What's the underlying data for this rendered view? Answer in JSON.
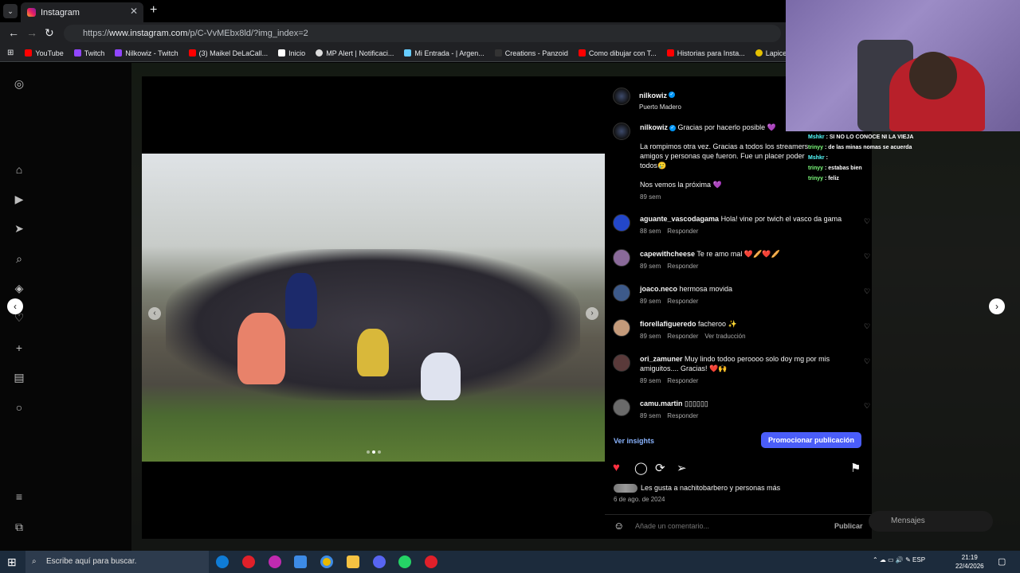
{
  "browser": {
    "tab_title": "Instagram",
    "url_prefix": "https://",
    "url_host": "www.instagram.com",
    "url_path": "/p/C-VvMEbx8ld/?img_index=2",
    "bookmarks": [
      "YouTube",
      "Twitch",
      "Nilkowiz - Twitch",
      "(3) Maikel DeLaCall...",
      "Inicio",
      "MP Alert | Notificaci...",
      "Mi Entrada - | Argen...",
      "Creations - Panzoid",
      "Como dibujar con T...",
      "Historias para Insta...",
      "Lapices Prismacolor..."
    ]
  },
  "post": {
    "author": "nilkowiz",
    "location": "Puerto Madero",
    "caption_author": "nilkowiz",
    "caption_title": "Gracias por hacerlo posible 💜",
    "caption_body": "La rompimos otra vez. Gracias a todos los streamers amigos y personas que fueron. Fue un placer poder todos🥲",
    "caption_outro": "Nos vemos la próxima 💜",
    "caption_time": "89 sem",
    "comments": [
      {
        "user": "aguante_vascodagama",
        "text": "Hola! vine por twich el vasco da gama",
        "time": "88 sem",
        "reply": "Responder",
        "extra": ""
      },
      {
        "user": "capewithcheese",
        "text": "Te re amo mal ❤️🥖❤️🥖",
        "time": "89 sem",
        "reply": "Responder",
        "extra": ""
      },
      {
        "user": "joaco.neco",
        "text": "hermosa movida",
        "time": "89 sem",
        "reply": "Responder",
        "extra": ""
      },
      {
        "user": "fiorellafigueredo",
        "text": "facheroo ✨",
        "time": "89 sem",
        "reply": "Responder",
        "extra": "Ver traducción"
      },
      {
        "user": "ori_zamuner",
        "text": "Muy lindo todoo peroooo solo doy mg por mis amiguitos.... Gracias! ❤️🙌",
        "time": "89 sem",
        "reply": "Responder",
        "extra": ""
      },
      {
        "user": "camu.martin",
        "text": "▯▯▯▯▯▯",
        "time": "89 sem",
        "reply": "Responder",
        "extra": ""
      }
    ],
    "insights_label": "Ver insights",
    "promote_label": "Promocionar publicación",
    "likes_text": "Les gusta a nachitobarbero y personas más",
    "date": "6 de ago. de 2024",
    "comment_placeholder": "Añade un comentario...",
    "publish_label": "Publicar"
  },
  "messages_label": "Mensajes",
  "chat": [
    {
      "user": "Mshkr",
      "text": ": SI NO LO CONOCE NI LA VIEJA"
    },
    {
      "user": "trinyy",
      "text": ": de las minas nomas se acuerda"
    },
    {
      "user": "Mshkr",
      "text": ":"
    },
    {
      "user": "trinyy",
      "text": ": estabas bien"
    },
    {
      "user": "trinyy",
      "text": ": feliz"
    }
  ],
  "taskbar": {
    "search_placeholder": "Escribe aquí para buscar.",
    "lang": "ESP",
    "time": "21:19",
    "date": "22/4/2026"
  },
  "colors": {
    "accent": "#4a5df9",
    "like": "#ff3040",
    "verified": "#0095f6"
  }
}
